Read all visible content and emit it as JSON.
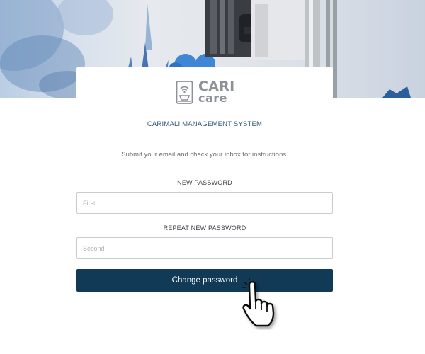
{
  "brand": {
    "logo_line1": "CARI",
    "logo_line2": "care",
    "system_name": "CARIMALI MANAGEMENT SYSTEM"
  },
  "form": {
    "instructions": "Submit your email and check your inbox for instructions.",
    "new_password": {
      "label": "NEW PASSWORD",
      "placeholder": "First",
      "value": ""
    },
    "repeat_password": {
      "label": "REPEAT NEW PASSWORD",
      "placeholder": "Second",
      "value": ""
    },
    "submit_label": "Change password"
  },
  "icons": {
    "logo": "coffee-machine-wifi-icon",
    "cursor": "hand-pointer-icon"
  },
  "colors": {
    "primary_button": "#103a55",
    "system_name_text": "#2f5877",
    "logo_gray": "#8e9196",
    "input_border": "#c9ccd0"
  }
}
